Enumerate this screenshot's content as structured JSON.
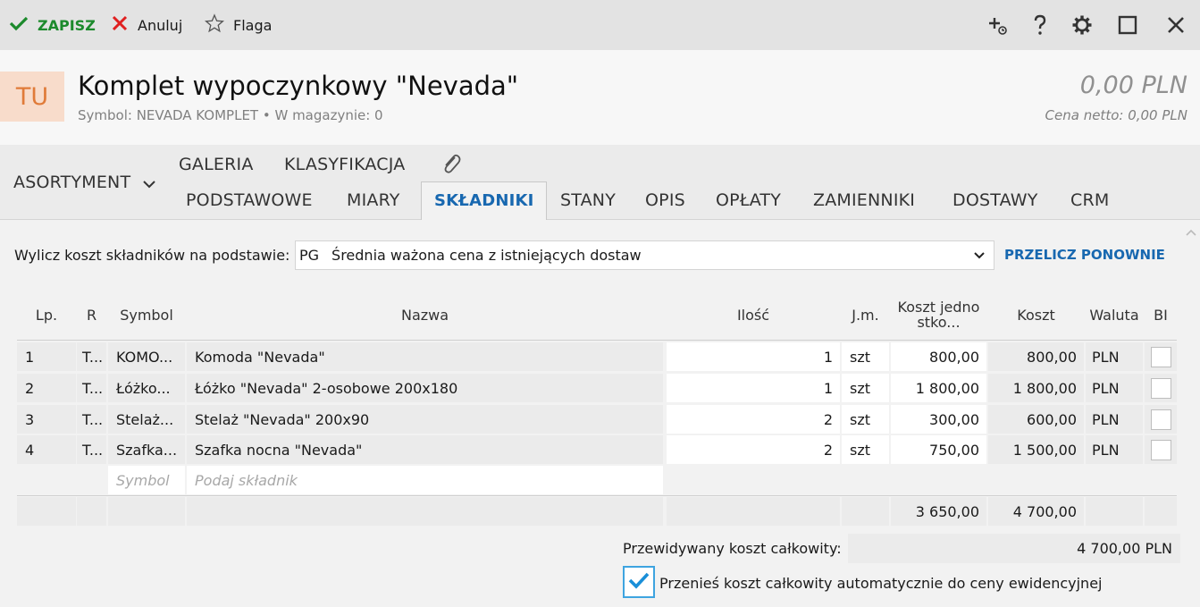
{
  "toolbar": {
    "save_label": "ZAPISZ",
    "cancel_label": "Anuluj",
    "flag_label": "Flaga",
    "icons": [
      "check-icon",
      "x-icon",
      "star-outline-icon",
      "add-linked-icon",
      "help-icon",
      "gear-icon",
      "maximize-icon",
      "close-icon"
    ],
    "save_color": "#1c8a2c",
    "cancel_color": "#e02020"
  },
  "header": {
    "avatar": "TU",
    "title": "Komplet wypoczynkowy \"Nevada\"",
    "subtitle": "Symbol: NEVADA KOMPLET  •  W magazynie: 0",
    "price": "0,00 PLN",
    "netto": "Cena netto: 0,00 PLN",
    "avatar_bg": "#f8dccb",
    "avatar_color": "#e07b39"
  },
  "tabs": {
    "asortyment": "ASORTYMENT",
    "row1": [
      "GALERIA",
      "KLASYFIKACJA"
    ],
    "row2": [
      "PODSTAWOWE",
      "MIARY",
      "SKŁADNIKI",
      "STANY",
      "OPIS",
      "OPŁATY",
      "ZAMIENNIKI",
      "DOSTAWY",
      "CRM"
    ],
    "active": "SKŁADNIKI",
    "active_color": "#1868b0"
  },
  "calc": {
    "label": "Wylicz koszt składników na podstawie:",
    "select_code": "PG",
    "select_text": "Średnia ważona cena z istniejących dostaw",
    "recalc_label": "PRZELICZ PONOWNIE"
  },
  "grid": {
    "columns": [
      "Lp.",
      "R",
      "Symbol",
      "Nazwa",
      "Ilość",
      "J.m.",
      "Koszt jednostko...",
      "Koszt",
      "Waluta",
      "BI"
    ],
    "rows": [
      {
        "lp": "1",
        "r": "T...",
        "symbol": "KOMO...",
        "nazwa": "Komoda \"Nevada\"",
        "ilosc": "1",
        "jm": "szt",
        "koszt_j": "800,00",
        "koszt": "800,00",
        "waluta": "PLN",
        "bi": false
      },
      {
        "lp": "2",
        "r": "T...",
        "symbol": "Łóżko...",
        "nazwa": "Łóżko \"Nevada\" 2-osobowe 200x180",
        "ilosc": "1",
        "jm": "szt",
        "koszt_j": "1 800,00",
        "koszt": "1 800,00",
        "waluta": "PLN",
        "bi": false
      },
      {
        "lp": "3",
        "r": "T...",
        "symbol": "Stelaż...",
        "nazwa": "Stelaż \"Nevada\" 200x90",
        "ilosc": "2",
        "jm": "szt",
        "koszt_j": "300,00",
        "koszt": "600,00",
        "waluta": "PLN",
        "bi": false
      },
      {
        "lp": "4",
        "r": "T...",
        "symbol": "Szafka...",
        "nazwa": "Szafka nocna \"Nevada\"",
        "ilosc": "2",
        "jm": "szt",
        "koszt_j": "750,00",
        "koszt": "1 500,00",
        "waluta": "PLN",
        "bi": false
      }
    ],
    "new_row": {
      "symbol_placeholder": "Symbol",
      "nazwa_placeholder": "Podaj składnik"
    },
    "totals": {
      "koszt_j": "3 650,00",
      "koszt": "4 700,00"
    }
  },
  "footer": {
    "total_label": "Przewidywany koszt całkowity:",
    "total_value": "4 700,00 PLN",
    "auto_label": "Przenieś koszt całkowity automatycznie do ceny ewidencyjnej",
    "auto_checked": true,
    "check_color": "#1a8fd8"
  }
}
